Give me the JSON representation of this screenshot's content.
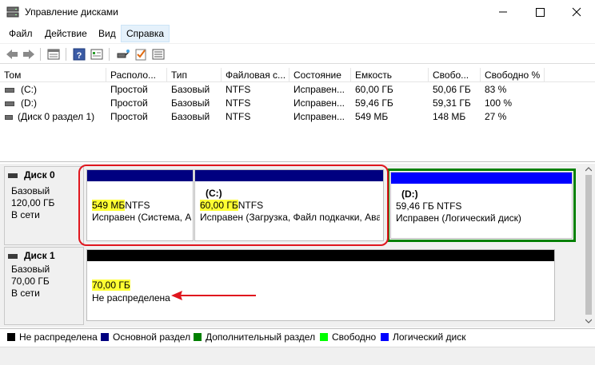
{
  "window": {
    "title": "Управление дисками"
  },
  "menu": {
    "items": [
      "Файл",
      "Действие",
      "Вид",
      "Справка"
    ],
    "active": "Справка"
  },
  "volume_table": {
    "columns": [
      "Том",
      "Располо...",
      "Тип",
      "Файловая с...",
      "Состояние",
      "Емкость",
      "Свобо...",
      "Свободно %"
    ],
    "rows": [
      [
        "(C:)",
        "Простой",
        "Базовый",
        "NTFS",
        "Исправен...",
        "60,00 ГБ",
        "50,06 ГБ",
        "83 %"
      ],
      [
        "(D:)",
        "Простой",
        "Базовый",
        "NTFS",
        "Исправен...",
        "59,46 ГБ",
        "59,31 ГБ",
        "100 %"
      ],
      [
        "(Диск 0 раздел 1)",
        "Простой",
        "Базовый",
        "NTFS",
        "Исправен...",
        "549 МБ",
        "148 МБ",
        "27 %"
      ]
    ]
  },
  "disks": [
    {
      "name": "Диск 0",
      "type": "Базовый",
      "size": "120,00 ГБ",
      "status": "В сети",
      "partitions": [
        {
          "label": "",
          "size": "549 МБ",
          "fs": "NTFS",
          "state": "Исправен (Система, А"
        },
        {
          "label": "(C:)",
          "size": "60,00 ГБ",
          "fs": "NTFS",
          "state": "Исправен (Загрузка, Файл подкачки, Ава"
        },
        {
          "label": "(D:)",
          "size": "59,46 ГБ NTFS",
          "fs": "",
          "state": "Исправен (Логический диск)"
        }
      ]
    },
    {
      "name": "Диск 1",
      "type": "Базовый",
      "size": "70,00 ГБ",
      "status": "В сети",
      "partitions": [
        {
          "label": "",
          "size": "70,00 ГБ",
          "fs": "",
          "state": "Не распределена"
        }
      ]
    }
  ],
  "legend": [
    {
      "label": "Не распределена",
      "color": "#000000"
    },
    {
      "label": "Основной раздел",
      "color": "#000080"
    },
    {
      "label": "Дополнительный раздел",
      "color": "#008000"
    },
    {
      "label": "Свободно",
      "color": "#00ff00"
    },
    {
      "label": "Логический диск",
      "color": "#0000ff"
    }
  ],
  "colors": {
    "primary": "#000080",
    "extended": "#008000",
    "logical": "#0000ff",
    "unallocated": "#000000",
    "annotation_red": "#e0161e",
    "highlight": "#ffff33",
    "menu_active": "#e5f1fb"
  },
  "icons": [
    "disk-management-app-icon",
    "minimize-icon",
    "maximize-icon",
    "close-icon",
    "back-arrow-icon",
    "forward-arrow-icon",
    "console-icon",
    "help-icon",
    "properties-icon",
    "connect-icon",
    "check-icon",
    "list-icon"
  ]
}
